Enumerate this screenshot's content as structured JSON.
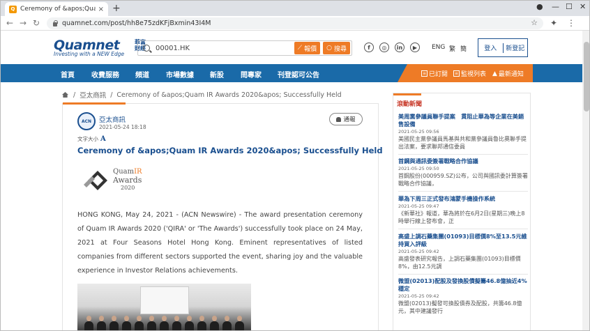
{
  "browser": {
    "tab_title": "Ceremony of &apos;Quam IR Aw",
    "url": "quamnet.com/post/hh8e75zdKFjBxmin43I4M",
    "new_tab": "+",
    "close_tab": "×"
  },
  "header": {
    "logo_text": "Quamnet",
    "logo_cn": "華富財經",
    "logo_tagline": "Investing with a NEW Edge",
    "search_value": "00001.HK",
    "quote_button": "報價",
    "search_button": "搜尋",
    "lang_en": "ENG",
    "lang_trad": "繁",
    "lang_simp": "簡",
    "login": "登入",
    "register": "新登記"
  },
  "nav": {
    "items": [
      "首頁",
      "收費服務",
      "頻道",
      "市場數據",
      "新股",
      "問專家",
      "刊登認可公告"
    ],
    "subscribed": "已訂閱",
    "watchlist": "監視列表",
    "notifications": "最新通知"
  },
  "breadcrumb": {
    "section": "亞太商訊",
    "current": "Ceremony of &apos;Quam IR Awards 2020&apos; Successfully Held",
    "separator": "/"
  },
  "article": {
    "author": "亞太商訊",
    "date": "2021-05-24 18:18",
    "report_label": "通報",
    "font_size_label": "文字大小",
    "font_size_icon": "A",
    "headline": "Ceremony of &apos;Quam IR Awards 2020&apos; Successfully Held",
    "award_logo_line1": "Quam",
    "award_logo_line1_accent": "IR",
    "award_logo_line2": "Awards",
    "award_logo_line3": "2020",
    "body": "HONG KONG, May 24, 2021 - (ACN Newswire) - The award presentation ceremony of Quam IR Awards 2020 ('QIRA' or 'The Awards') successfully took place on 24 May, 2021 at Four Seasons Hotel Hong Kong. Eminent representatives of listed companies from different sectors supported the event, sharing joy and the valuable experience in Investor Relations achievements."
  },
  "sidebar": {
    "title": "滾動新聞",
    "news": [
      {
        "title": "美周黨參議員聯手提案　貫阻止華為等企業在美銷售設備",
        "date": "2021-05-25 09:56",
        "summary": "美國民主黨參議員馬基與共和黨參議員魯比奧聯手提出法案，要求聯邦通信委員"
      },
      {
        "title": "首鋼與通訊委簽署戰略合作協議",
        "date": "2021-05-25 09:50",
        "summary": "首鋼股份(000959.SZ)公布，公司與國訊委計算簽署戰略合作協議，"
      },
      {
        "title": "華為下周三正式發布鴻蒙手機操作系統",
        "date": "2021-05-25 09:47",
        "summary": "《新華社》報道，華為將於在6月2日(星期三)晚上8時舉行線上發布會，正"
      },
      {
        "title": "高盛上調石藥集團(01093)目標價8%至13.5元維持買入評級",
        "date": "2021-05-25 09:42",
        "summary": "高盛發表研究報告，上調石藥集團(01093)目標價8%，由12.5元調"
      },
      {
        "title": "微盟(02013)配股及發換股債擬籌46.8億抽近4%穩定",
        "date": "2021-05-25 09:42",
        "summary": "微盟(02013)擬發可換股債券及配股，共籌46.8億元，其中建議發行"
      }
    ]
  },
  "colors": {
    "brand_blue": "#1a4f8f",
    "nav_blue": "#1a6aa8",
    "accent_orange": "#ee7b26",
    "sidebar_red": "#c83a2a"
  }
}
